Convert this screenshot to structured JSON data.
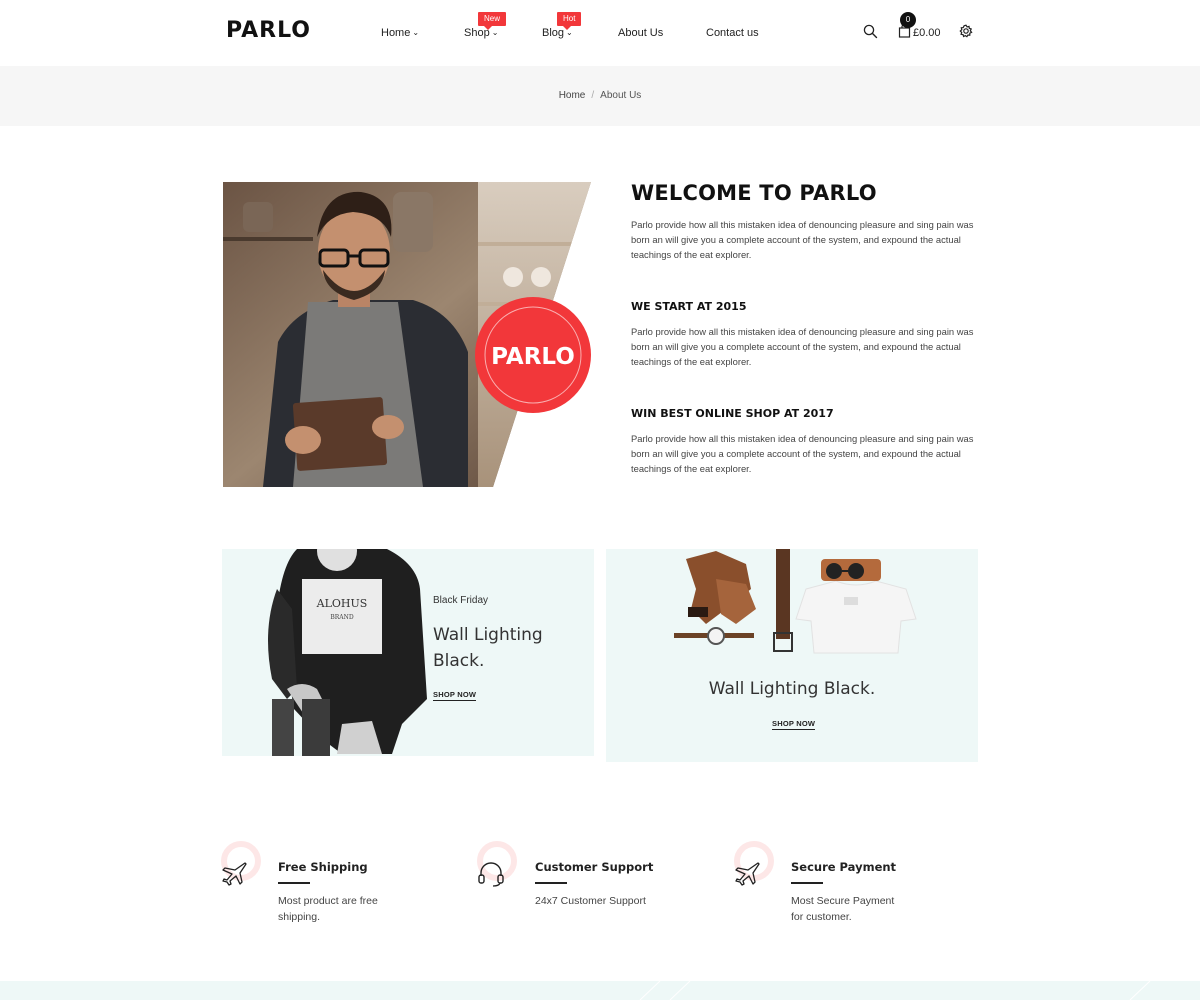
{
  "header": {
    "logo": "PARLO",
    "nav": [
      {
        "label": "Home",
        "has_dropdown": true
      },
      {
        "label": "Shop",
        "has_dropdown": true,
        "badge": "New"
      },
      {
        "label": "Blog",
        "has_dropdown": true,
        "badge": "Hot"
      },
      {
        "label": "About Us",
        "has_dropdown": false
      },
      {
        "label": "Contact us",
        "has_dropdown": false
      }
    ],
    "cart_count": "0",
    "cart_total": "£0.00",
    "icons": [
      "search-icon",
      "cart-icon",
      "gear-icon",
      "chevron-down-icon"
    ]
  },
  "breadcrumb": {
    "home": "Home",
    "separator": "/",
    "current": "About Us"
  },
  "about": {
    "badge_text": "PARLO",
    "title": "WELCOME TO PARLO",
    "intro": "Parlo provide how all this mistaken idea of denouncing pleasure and sing pain was born an will give you a complete account of the system, and expound the actual teachings of the eat explorer.",
    "sections": [
      {
        "heading": "WE START AT 2015",
        "text": "Parlo provide how all this mistaken idea of denouncing pleasure and sing pain was born an will give you a complete account of the system, and expound the actual teachings of the eat explorer."
      },
      {
        "heading": "WIN BEST ONLINE SHOP AT 2017",
        "text": "Parlo provide how all this mistaken idea of denouncing pleasure and sing pain was born an will give you a complete account of the system, and expound the actual teachings of the eat explorer."
      }
    ]
  },
  "banners": [
    {
      "eyebrow": "Black Friday",
      "title_line1": "Wall Lighting",
      "title_line2": "Black.",
      "cta": "SHOP NOW",
      "shirt_print": "ALOHUS BRAND"
    },
    {
      "title": "Wall Lighting Black.",
      "cta": "SHOP NOW"
    }
  ],
  "features": [
    {
      "icon": "airplane-icon",
      "title": "Free Shipping",
      "desc_line1": "Most product are free",
      "desc_line2": "shipping."
    },
    {
      "icon": "headset-icon",
      "title": "Customer Support",
      "desc_line1": "24x7 Customer Support",
      "desc_line2": ""
    },
    {
      "icon": "airplane-icon",
      "title": "Secure Payment",
      "desc_line1": "Most Secure Payment",
      "desc_line2": "for customer."
    }
  ],
  "colors": {
    "accent": "#f2373a",
    "banner_bg": "#eef8f7",
    "breadcrumb_bg": "#f6f6f6",
    "feature_ring": "#fde7e7",
    "text_dark": "#111111"
  }
}
